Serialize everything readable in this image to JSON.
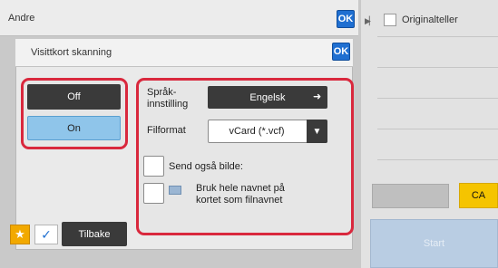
{
  "outer_window": {
    "title": "Andre",
    "ok_label": "OK"
  },
  "dialog": {
    "title": "Visittkort skanning",
    "ok_label": "OK",
    "mode": {
      "off_label": "Off",
      "on_label": "On",
      "selected": "On"
    },
    "language": {
      "label_line1": "Språk-",
      "label_line2": "innstilling",
      "value": "Engelsk"
    },
    "file_format": {
      "label": "Filformat",
      "value": "vCard (*.vcf)"
    },
    "send_image": {
      "label": "Send også bilde:",
      "checked": false
    },
    "use_name": {
      "label_line1": "Bruk hele navnet på",
      "label_line2": "kortet som filnavnet",
      "checked": false
    }
  },
  "right_panel": {
    "original_label": "Originalteller",
    "ca_label": "CA",
    "start_label": "Start"
  },
  "bottom_bar": {
    "back_label": "Tilbake"
  },
  "icons": {
    "lang_arrow": "arrow-right-icon",
    "format_dropdown": "triangle-down-icon",
    "favorite": "star-icon",
    "confirm": "checkmark-icon"
  },
  "colors": {
    "accent_red": "#d9283d",
    "ok_blue": "#1f6fd1",
    "selected_blue": "#8fc5ea",
    "dark_button": "#3a3a3a",
    "ca_yellow": "#f5c400"
  }
}
